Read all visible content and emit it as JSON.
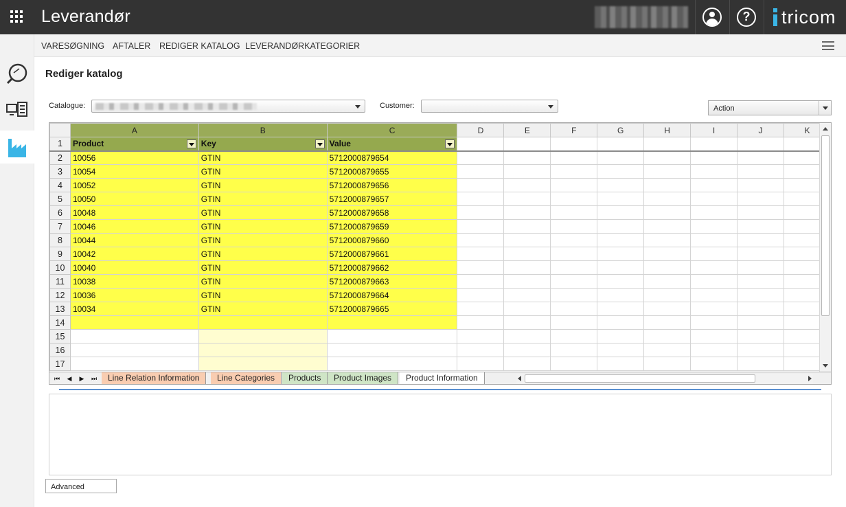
{
  "header": {
    "title": "Leverandør",
    "logo_text": "tricom",
    "help_glyph": "?"
  },
  "subnav": {
    "items": [
      "VARESØGNING",
      "AFTALER",
      "REDIGER KATALOG",
      "LEVERANDØRKATEGORIER"
    ]
  },
  "page": {
    "title": "Rediger katalog"
  },
  "filters": {
    "catalogue_label": "Catalogue:",
    "catalogue_value": "",
    "customer_label": "Customer:",
    "customer_value": "",
    "action_value": "Action"
  },
  "sheet": {
    "columns": [
      "A",
      "B",
      "C",
      "D",
      "E",
      "F",
      "G",
      "H",
      "I",
      "J",
      "K"
    ],
    "headers": [
      "Product",
      "Key",
      "Value"
    ],
    "rows": [
      [
        "10056",
        "GTIN",
        "5712000879654"
      ],
      [
        "10054",
        "GTIN",
        "5712000879655"
      ],
      [
        "10052",
        "GTIN",
        "5712000879656"
      ],
      [
        "10050",
        "GTIN",
        "5712000879657"
      ],
      [
        "10048",
        "GTIN",
        "5712000879658"
      ],
      [
        "10046",
        "GTIN",
        "5712000879659"
      ],
      [
        "10044",
        "GTIN",
        "5712000879660"
      ],
      [
        "10042",
        "GTIN",
        "5712000879661"
      ],
      [
        "10040",
        "GTIN",
        "5712000879662"
      ],
      [
        "10038",
        "GTIN",
        "5712000879663"
      ],
      [
        "10036",
        "GTIN",
        "5712000879664"
      ],
      [
        "10034",
        "GTIN",
        "5712000879665"
      ]
    ],
    "row_numbers": [
      "1",
      "2",
      "3",
      "4",
      "5",
      "6",
      "7",
      "8",
      "9",
      "10",
      "11",
      "12",
      "13",
      "14",
      "15",
      "16",
      "17"
    ],
    "tabs": [
      "Line Relation Information",
      "Line Categories",
      "Products",
      "Product Images",
      "Product Information"
    ],
    "nav": [
      "⏮",
      "◀",
      "▶",
      "⏭"
    ]
  },
  "footer": {
    "advanced_label": "Advanced"
  },
  "colors": {
    "topbar": "#333333",
    "accent": "#3ab5e6",
    "highlight": "#ffff4a",
    "header_green": "#95a94e"
  }
}
